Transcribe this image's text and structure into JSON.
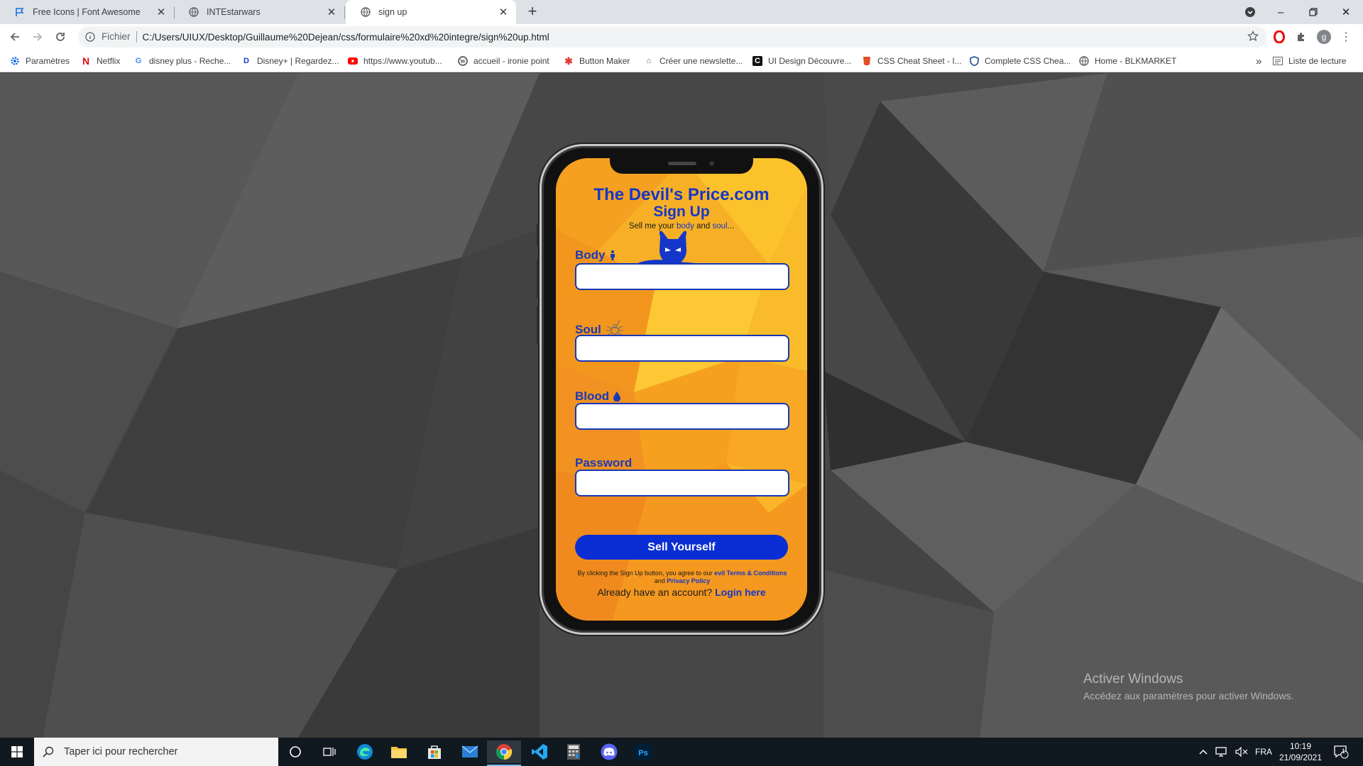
{
  "tabs": [
    {
      "title": "Free Icons | Font Awesome",
      "icon": "font-awesome-flag-icon"
    },
    {
      "title": "INTEstarwars",
      "icon": "globe-icon"
    },
    {
      "title": "sign up",
      "icon": "globe-icon",
      "active": true
    }
  ],
  "toolbar": {
    "scheme": "Fichier",
    "url": "C:/Users/UIUX/Desktop/Guillaume%20Dejean/css/formulaire%20xd%20integre/sign%20up.html",
    "profile_initial": "g"
  },
  "bookmarks": [
    {
      "label": "Paramètres",
      "icon": "gear-icon"
    },
    {
      "label": "Netflix",
      "icon": "netflix-icon"
    },
    {
      "label": "disney plus - Reche...",
      "icon": "google-icon"
    },
    {
      "label": "Disney+ | Regardez...",
      "icon": "disney-icon"
    },
    {
      "label": "https://www.youtub...",
      "icon": "youtube-icon"
    },
    {
      "label": "accueil - ironie point",
      "icon": "wordpress-icon"
    },
    {
      "label": "Button Maker",
      "icon": "button-maker-icon"
    },
    {
      "label": "Créer une newslette...",
      "icon": "newsletter-icon"
    },
    {
      "label": "UI Design Découvre...",
      "icon": "c-icon"
    },
    {
      "label": "CSS Cheat Sheet - I...",
      "icon": "css-icon"
    },
    {
      "label": "Complete CSS Chea...",
      "icon": "shield-icon"
    },
    {
      "label": "Home - BLKMARKET",
      "icon": "globe-icon"
    }
  ],
  "bookmarks_more": "»",
  "reading_list": "Liste de lecture",
  "form": {
    "brand": "The Devil's Price.com",
    "heading": "Sign Up",
    "tagline_pre": "Sell me your ",
    "tagline_body": "body",
    "tagline_mid": " and ",
    "tagline_soul": "soul",
    "tagline_post": "...",
    "fields": [
      {
        "label": "Body",
        "icon": "person-icon"
      },
      {
        "label": "Soul",
        "icon": "spider-icon"
      },
      {
        "label": "Blood",
        "icon": "blood-drop-icon"
      },
      {
        "label": "Password",
        "icon": ""
      }
    ],
    "submit": "Sell Yourself",
    "terms_pre": "By clicking the Sign Up button, you agree to our ",
    "terms_link": "evil Terms & Conditions",
    "terms_mid": " and ",
    "terms_link2": "Privacy Policy",
    "login_pre": "Already have an account? ",
    "login_link": "Login here"
  },
  "watermark": {
    "title": "Activer Windows",
    "subtitle": "Accédez aux paramètres pour activer Windows."
  },
  "taskbar": {
    "search_placeholder": "Taper ici pour rechercher",
    "lang": "FRA",
    "time": "10:19",
    "date": "21/09/2021",
    "notif_count": "1"
  },
  "colors": {
    "accent_blue": "#1437c9",
    "button_blue": "#0a2ed4",
    "screen_orange": "#f6a623"
  }
}
